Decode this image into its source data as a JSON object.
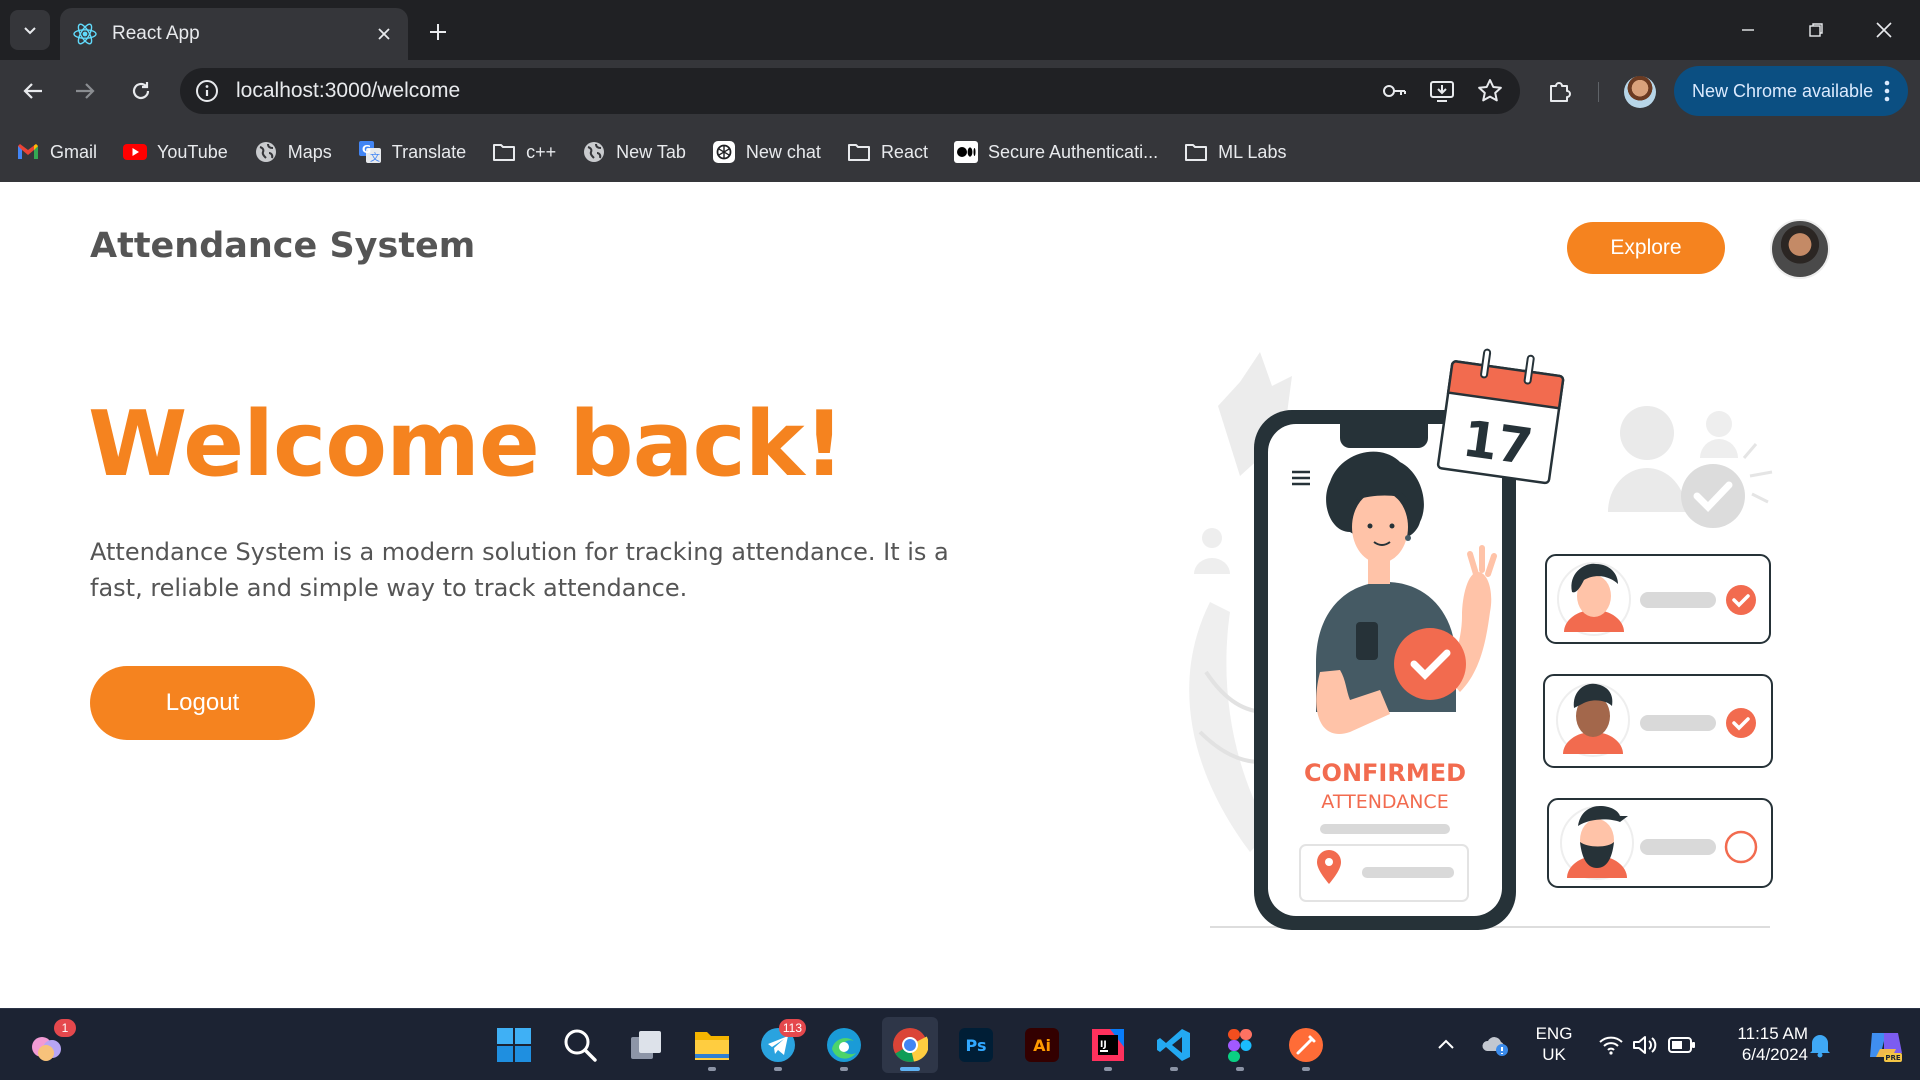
{
  "browser": {
    "tab_title": "React App",
    "url": "localhost:3000/welcome",
    "new_chrome_label": "New Chrome available"
  },
  "bookmarks": [
    {
      "label": "Gmail",
      "icon": "gmail-icon"
    },
    {
      "label": "YouTube",
      "icon": "youtube-icon"
    },
    {
      "label": "Maps",
      "icon": "globe-icon"
    },
    {
      "label": "Translate",
      "icon": "translate-icon"
    },
    {
      "label": "c++",
      "icon": "folder-icon"
    },
    {
      "label": "New Tab",
      "icon": "globe-icon"
    },
    {
      "label": "New chat",
      "icon": "chatgpt-icon"
    },
    {
      "label": "React",
      "icon": "folder-icon"
    },
    {
      "label": "Secure Authenticati...",
      "icon": "medium-icon"
    },
    {
      "label": "ML Labs",
      "icon": "folder-icon"
    }
  ],
  "page": {
    "brand": "Attendance System",
    "explore_label": "Explore",
    "hero_title": "Welcome back!",
    "hero_description": "Attendance System is a modern solution for tracking attendance. It is a fast, reliable and simple way to track attendance.",
    "logout_label": "Logout",
    "accent_color": "#f5831f"
  },
  "illustration": {
    "calendar_day": "17",
    "confirmed_label": "CONFIRMED",
    "attendance_label": "ATTENDANCE"
  },
  "taskbar": {
    "widget_badge": "1",
    "telegram_badge": "113",
    "lang_top": "ENG",
    "lang_bottom": "UK",
    "time": "11:15 AM",
    "date": "6/4/2024"
  }
}
